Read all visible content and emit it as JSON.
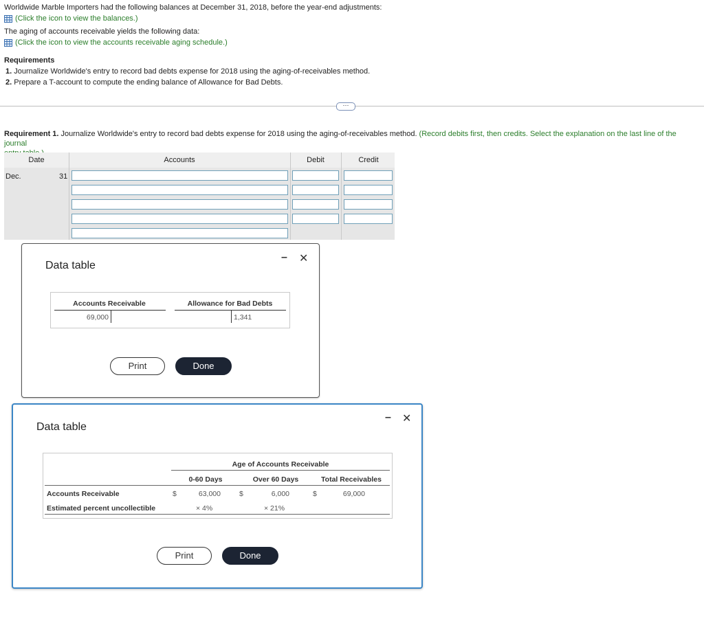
{
  "intro": {
    "line1": "Worldwide Marble Importers had the following balances at December 31, 2018, before the year-end adjustments:",
    "link1": "(Click the icon to view the balances.)",
    "line2": "The aging of accounts receivable yields the following data:",
    "link2": "(Click the icon to view the accounts receivable aging schedule.)"
  },
  "requirements": {
    "title": "Requirements",
    "items": [
      {
        "num": "1.",
        "text": "Journalize Worldwide's entry to record bad debts expense for 2018 using the aging-of-receivables method."
      },
      {
        "num": "2.",
        "text": "Prepare a T-account to compute the ending balance of Allowance for Bad Debts."
      }
    ]
  },
  "more_button": "⋯",
  "req1": {
    "label": "Requirement 1.",
    "text": " Journalize Worldwide's entry to record bad debts expense for 2018 using the aging-of-receivables method.",
    "hint1": " (Record debits first, then credits. Select the explanation on the last line of the journal",
    "hint2": "entry table.)"
  },
  "journal": {
    "headers": {
      "date": "Date",
      "accounts": "Accounts",
      "debit": "Debit",
      "credit": "Credit"
    },
    "month": "Dec.",
    "day": "31"
  },
  "dialog1": {
    "title": "Data table",
    "t_accounts": [
      {
        "name": "Accounts Receivable",
        "value": "69,000"
      },
      {
        "name": "Allowance for Bad Debts",
        "value": "1,341"
      }
    ],
    "print": "Print",
    "done": "Done",
    "minimize": "–",
    "close": "✕"
  },
  "dialog2": {
    "title": "Data table",
    "group_header": "Age of Accounts Receivable",
    "columns": [
      "0-60 Days",
      "Over 60 Days",
      "Total Receivables"
    ],
    "rows": [
      {
        "label": "Accounts Receivable",
        "currency": "$",
        "values": [
          "63,000",
          "6,000",
          "69,000"
        ]
      },
      {
        "label": "Estimated percent uncollectible",
        "values": [
          "× 4%",
          "× 21%"
        ]
      }
    ],
    "print": "Print",
    "done": "Done",
    "minimize": "–",
    "close": "✕"
  },
  "colors": {
    "link_green": "#2a7d2a",
    "dialog_border_blue": "#3b86c6",
    "done_dark": "#1c2433"
  }
}
